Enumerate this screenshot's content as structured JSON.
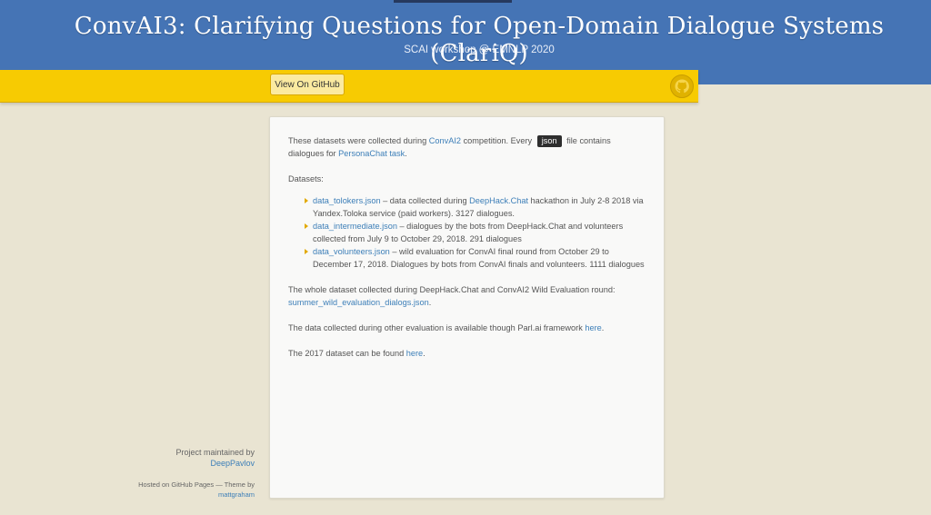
{
  "header": {
    "title": "ConvAI3: Clarifying Questions for Open-Domain Dialogue Systems (ClariQ)",
    "subtitle": "SCAI workshop @ EMNLP 2020"
  },
  "toolbar": {
    "github_button": "View On GitHub",
    "github_icon": "github-octocat-icon"
  },
  "content": {
    "p1": {
      "t1": "These datasets were collected during",
      "link_convai2": "ConvAI2",
      "t2": "competition. Every",
      "code": "json",
      "t3": "file contains dialogues for",
      "link_persona": "PersonaChat task",
      "t4": "."
    },
    "datasets_label": "Datasets:",
    "datasets": [
      {
        "link": "data_tolokers.json",
        "t1": " – data collected during ",
        "link2": "DeepHack.Chat",
        "t2": " hackathon in July 2-8 2018 via Yandex.Toloka service (paid workers). 3127 dialogues."
      },
      {
        "link": "data_intermediate.json",
        "t1": " – dialogues by the bots from DeepHack.Chat and volunteers collected from July 9 to October 29, 2018. 291 dialogues"
      },
      {
        "link": "data_volunteers.json",
        "t1": " – wild evaluation for ConvAI final round from October 29 to December 17, 2018. Dialogues by bots from ConvAI finals and volunteers. 1111 dialogues"
      }
    ],
    "p2": {
      "t1": "The whole dataset collected during DeepHack.Chat and ConvAI2 Wild Evaluation round:",
      "link": "summer_wild_evaluation_dialogs.json",
      "t2": "."
    },
    "p3": {
      "t1": "The data collected during other evaluation is available though Parl.ai framework",
      "link": "here",
      "t2": "."
    },
    "p4": {
      "t1": "The 2017 dataset can be found",
      "link": "here",
      "t2": "."
    }
  },
  "sidebar": {
    "maintained_text": "Project maintained by",
    "maintainer_link": "DeepPavlov",
    "hosted_text": "Hosted on GitHub Pages — Theme by",
    "theme_author_link": "mattgraham"
  }
}
